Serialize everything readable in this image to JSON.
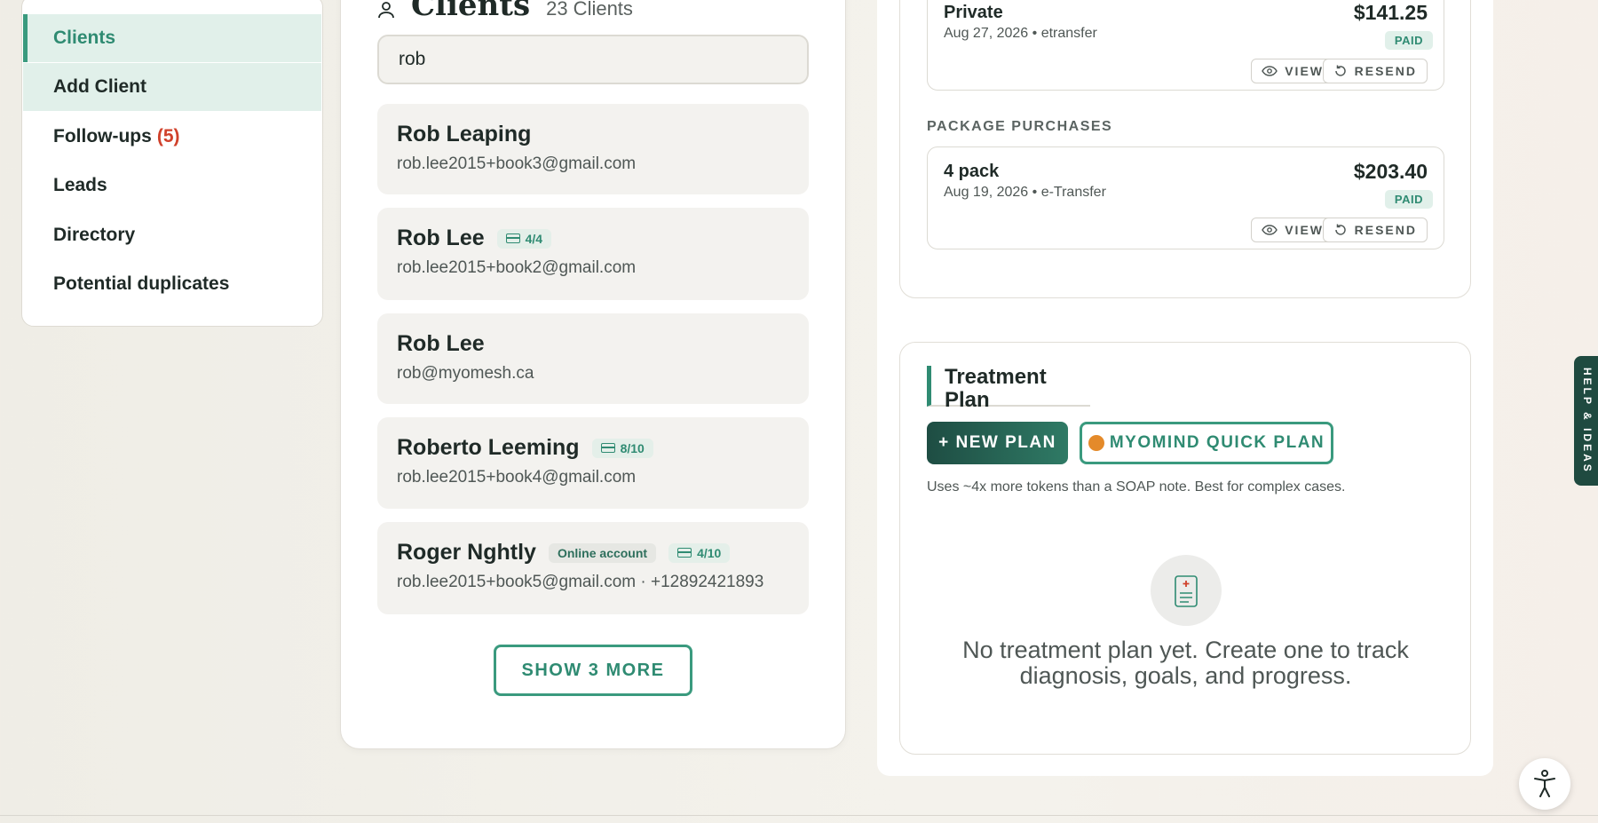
{
  "sidebar": {
    "items": [
      {
        "label": "Clients"
      },
      {
        "label": "Add Client"
      },
      {
        "label": "Follow-ups",
        "count": "(5)"
      },
      {
        "label": "Leads"
      },
      {
        "label": "Directory"
      },
      {
        "label": "Potential duplicates"
      }
    ]
  },
  "clients": {
    "title": "Clients",
    "count_label": "23 Clients",
    "search_value": "rob",
    "list": [
      {
        "name": "Rob Leaping",
        "email": "rob.lee2015+book3@gmail.com"
      },
      {
        "name": "Rob Lee",
        "pass": "4/4",
        "email": "rob.lee2015+book2@gmail.com"
      },
      {
        "name": "Rob Lee",
        "email": "rob@myomesh.ca"
      },
      {
        "name": "Roberto Leeming",
        "pass": "8/10",
        "email": "rob.lee2015+book4@gmail.com"
      },
      {
        "name": "Roger Nghtly",
        "badge": "Online account",
        "pass": "4/10",
        "email": "rob.lee2015+book5@gmail.com · +12892421893"
      }
    ],
    "show_more_label": "SHOW 3 MORE"
  },
  "billing": {
    "invoices": [
      {
        "title": "Private",
        "meta": "Aug 27, 2026 • etransfer",
        "amount": "$141.25",
        "status": "PAID"
      }
    ],
    "section_label": "PACKAGE PURCHASES",
    "packages": [
      {
        "title": "4 pack",
        "meta": "Aug 19, 2026 • e-Transfer",
        "amount": "$203.40",
        "status": "PAID"
      }
    ],
    "view_label": "VIEW",
    "resend_label": "RESEND"
  },
  "treatment_plan": {
    "title": "Treatment Plan",
    "new_plan_label": "+ NEW PLAN",
    "quick_plan_label": "MYOMIND QUICK PLAN",
    "note": "Uses ~4x more tokens than a SOAP note. Best for complex cases.",
    "empty_line1": "No treatment plan yet. Create one to track",
    "empty_line2": "diagnosis, goals, and progress."
  },
  "help_tab_label": "HELP & IDEAS",
  "colors": {
    "accent": "#2f8b72",
    "dark": "#1f4a40",
    "danger": "#d0412b",
    "orange": "#e48a2a"
  },
  "icons": [
    "user-icon",
    "pass-card-icon",
    "eye-icon",
    "resend-icon",
    "clipboard-icon",
    "accessibility-icon"
  ]
}
